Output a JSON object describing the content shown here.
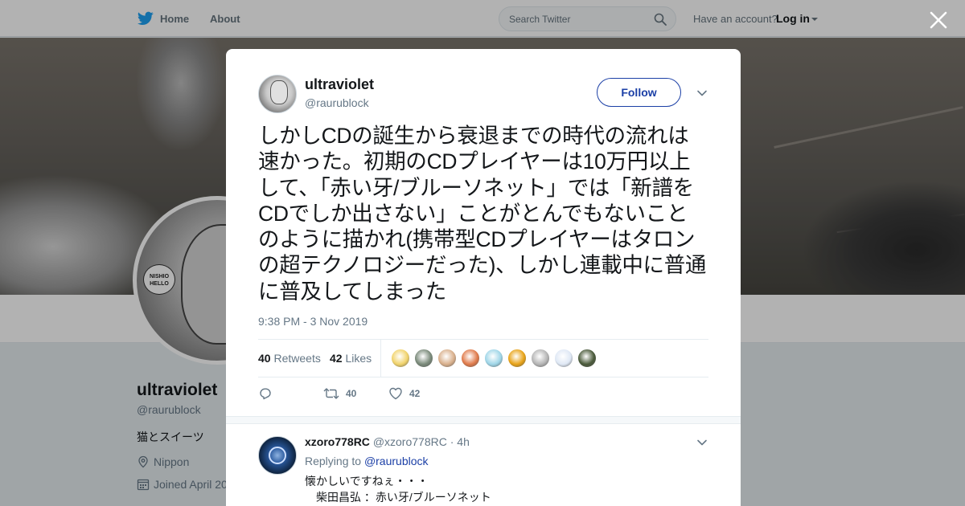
{
  "nav": {
    "home_label": "Home",
    "about_label": "About",
    "search_placeholder": "Search Twitter",
    "account_text": "Have an account?",
    "login_label": "Log in",
    "brand_color": "#1da1f2"
  },
  "profile": {
    "name": "ultraviolet",
    "handle": "@raurublock",
    "bio": "猫とスイーツ",
    "location": "Nippon",
    "joined": "Joined April 20",
    "avatar_bubble": "NISHIO HELLO"
  },
  "tweet": {
    "author_name": "ultraviolet",
    "author_handle": "@raurublock",
    "follow_label": "Follow",
    "text": "しかしCDの誕生から衰退までの時代の流れは速かった。初期のCDプレイヤーは10万円以上して、「赤い牙/ブルーソネット」では「新譜をCDでしか出さない」ことがとんでもないことのように描かれ(携帯型CDプレイヤーはタロンの超テクノロジーだった)、しかし連載中に普通に普及してしまった",
    "timestamp": "9:38 PM - 3 Nov 2019",
    "retweets_count": "40",
    "retweets_label": "Retweets",
    "likes_count": "42",
    "likes_label": "Likes",
    "action_retweet_count": "40",
    "action_like_count": "42",
    "likers": [
      {
        "color": "#f1d36b"
      },
      {
        "color": "#7a8a7a"
      },
      {
        "color": "#d9b08c"
      },
      {
        "color": "#e07a4a"
      },
      {
        "color": "#9fd6e8"
      },
      {
        "color": "#e8a317"
      },
      {
        "color": "#b5b5b5"
      },
      {
        "color": "#dfe8f5"
      },
      {
        "color": "#4a5a3a"
      }
    ]
  },
  "reply": {
    "name": "xzoro778RC",
    "handle": "@xzoro778RC",
    "time": "· 4h",
    "replying_to_label": "Replying to",
    "replying_to_handle": "@raurublock",
    "line1": "懐かしいですねぇ・・・",
    "line2": "柴田昌弘 ：赤い牙/ブルーソネット"
  },
  "colors": {
    "link": "#1b3fa6",
    "muted": "#657786",
    "text": "#14171a"
  }
}
